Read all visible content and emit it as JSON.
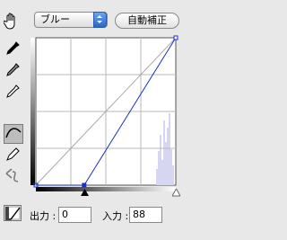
{
  "channel": {
    "selected": "ブルー"
  },
  "auto_button": {
    "label": "自動補正"
  },
  "output": {
    "label": "出力 :",
    "value": "0"
  },
  "input": {
    "label": "入力 :",
    "value": "88"
  },
  "curve": {
    "line_color": "#1a2fd0",
    "points": [
      {
        "input": 0,
        "output": 0
      },
      {
        "input": 88,
        "output": 0
      },
      {
        "input": 255,
        "output": 255
      }
    ]
  },
  "icons": [
    "hand-icon",
    "black-eyedropper-icon",
    "gray-eyedropper-icon",
    "white-eyedropper-icon",
    "curve-tool-icon",
    "pencil-tool-icon",
    "smooth-icon",
    "graph-options-icon"
  ]
}
